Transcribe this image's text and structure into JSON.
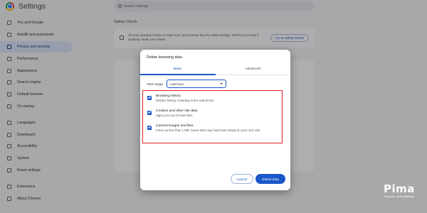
{
  "app": {
    "title": "Settings"
  },
  "search": {
    "placeholder": "Search settings"
  },
  "sidebar": {
    "items": [
      {
        "label": "You and Google",
        "icon": "person-icon"
      },
      {
        "label": "Autofill and passwords",
        "icon": "clipboard-icon"
      },
      {
        "label": "Privacy and security",
        "icon": "shield-icon",
        "active": true
      },
      {
        "label": "Performance",
        "icon": "speedometer-icon"
      },
      {
        "label": "Appearance",
        "icon": "palette-icon"
      },
      {
        "label": "Search engine",
        "icon": "search-icon"
      },
      {
        "label": "Default browser",
        "icon": "browser-icon"
      },
      {
        "label": "On startup",
        "icon": "power-icon"
      },
      {
        "label": "Languages",
        "icon": "translate-icon"
      },
      {
        "label": "Downloads",
        "icon": "download-icon"
      },
      {
        "label": "Accessibility",
        "icon": "accessibility-icon"
      },
      {
        "label": "System",
        "icon": "wrench-icon"
      },
      {
        "label": "Reset settings",
        "icon": "reset-icon"
      },
      {
        "label": "Extensions",
        "icon": "puzzle-icon"
      },
      {
        "label": "About Chrome",
        "icon": "chrome-icon"
      }
    ]
  },
  "safety_check": {
    "heading": "Safety Check",
    "text": "Chrome regularly checks to make sure your browser has the safest settings. We'll let you know if anything needs your review.",
    "button": "Go to Safety Check"
  },
  "dialog": {
    "title": "Delete browsing data",
    "tabs": [
      {
        "label": "Basic",
        "active": true
      },
      {
        "label": "Advanced"
      }
    ],
    "time_range": {
      "label": "Time range",
      "value": "Last hour"
    },
    "options": [
      {
        "title": "Browsing history",
        "desc": "Deletes history, including in the search box",
        "checked": true
      },
      {
        "title": "Cookies and other site data",
        "desc": "Signs you out of most sites",
        "checked": true
      },
      {
        "title": "Cached images and files",
        "desc": "Frees up less than 1 MB. Some sites may load more slowly on your next visit.",
        "checked": true
      }
    ],
    "cancel": "Cancel",
    "delete": "Delete data"
  },
  "colors": {
    "accent": "#1a57c8",
    "highlight_border": "#e02424"
  },
  "watermark": {
    "logo": "Pima",
    "tagline": "Empower Online Business"
  }
}
